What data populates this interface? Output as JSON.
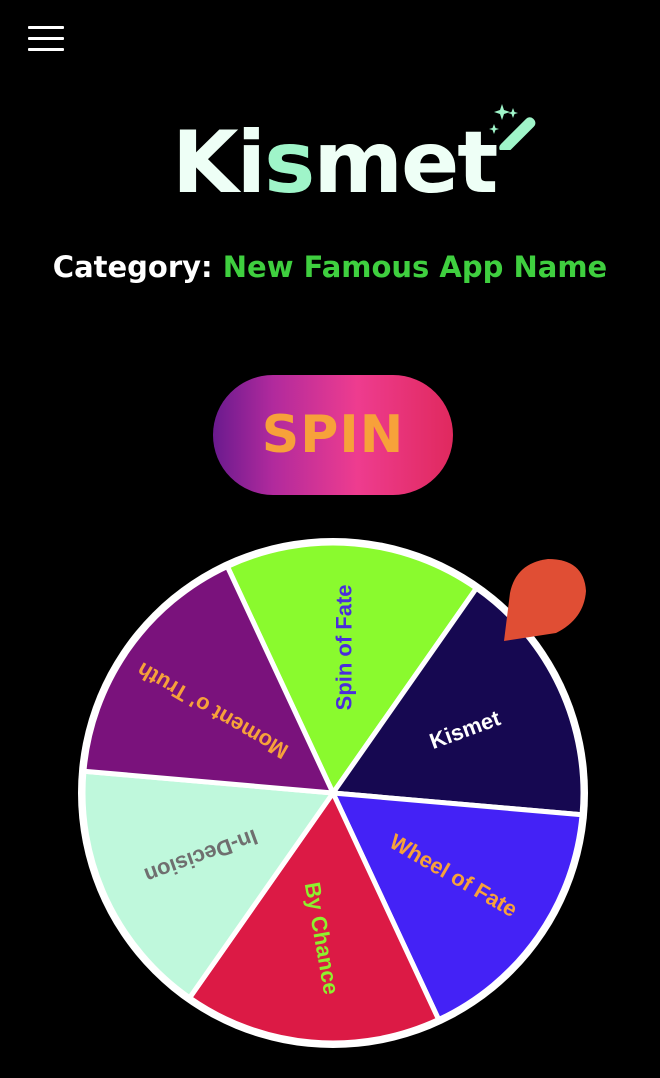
{
  "app": {
    "logo_text_1": "Ki",
    "logo_text_2": "s",
    "logo_text_3": "met",
    "icons": {
      "menu": "hamburger-menu-icon",
      "logo": "magic-wand-icon",
      "pointer": "wheel-pointer"
    }
  },
  "category": {
    "label": "Category:",
    "value": "New Famous App Name"
  },
  "spin": {
    "label": "SPIN"
  },
  "wheel": {
    "segments": [
      {
        "label": "Spin of Fate",
        "fill": "#8afa2e",
        "text_color": "#4a2ddb"
      },
      {
        "label": "Kismet",
        "fill": "#160851",
        "text_color": "#ffffff"
      },
      {
        "label": "Wheel of Fate",
        "fill": "#4422f6",
        "text_color": "#f7a13a"
      },
      {
        "label": "By Chance",
        "fill": "#dc1a45",
        "text_color": "#8ef02e"
      },
      {
        "label": "In-Decision",
        "fill": "#bff8dc",
        "text_color": "#6f6f6f"
      },
      {
        "label": "Moment o' Truth",
        "fill": "#7a127c",
        "text_color": "#f7a13a"
      }
    ]
  },
  "colors": {
    "background": "#000000",
    "logo_text": "#eefff6",
    "logo_accent": "#9ff5c9",
    "category_value": "#3fcf3f",
    "spin_text": "#f7a13a",
    "pointer": "#e04e34",
    "wheel_border": "#ffffff"
  }
}
